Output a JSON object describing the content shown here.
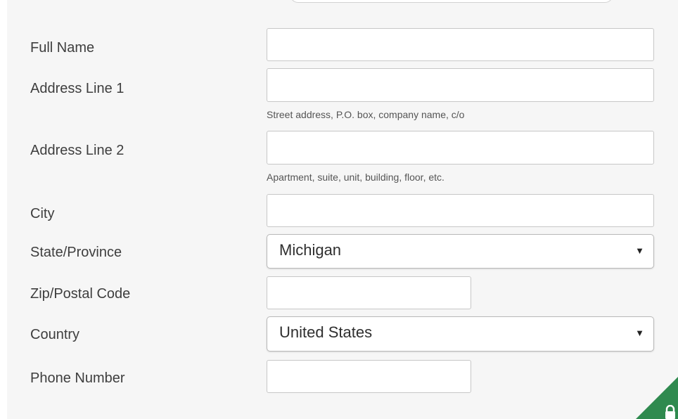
{
  "form": {
    "full_name": {
      "label": "Full Name",
      "value": ""
    },
    "address_line1": {
      "label": "Address Line 1",
      "value": "",
      "hint": "Street address, P.O. box, company name, c/o"
    },
    "address_line2": {
      "label": "Address Line 2",
      "value": "",
      "hint": "Apartment, suite, unit, building, floor, etc."
    },
    "city": {
      "label": "City",
      "value": ""
    },
    "state": {
      "label": "State/Province",
      "selected": "Michigan",
      "arrow": "▼"
    },
    "zip": {
      "label": "Zip/Postal Code",
      "value": ""
    },
    "country": {
      "label": "Country",
      "selected": "United States",
      "arrow": "▼"
    },
    "phone": {
      "label": "Phone Number",
      "value": ""
    }
  },
  "corner_badge": {
    "icon": "lock-icon",
    "color": "#2f8a4f"
  }
}
